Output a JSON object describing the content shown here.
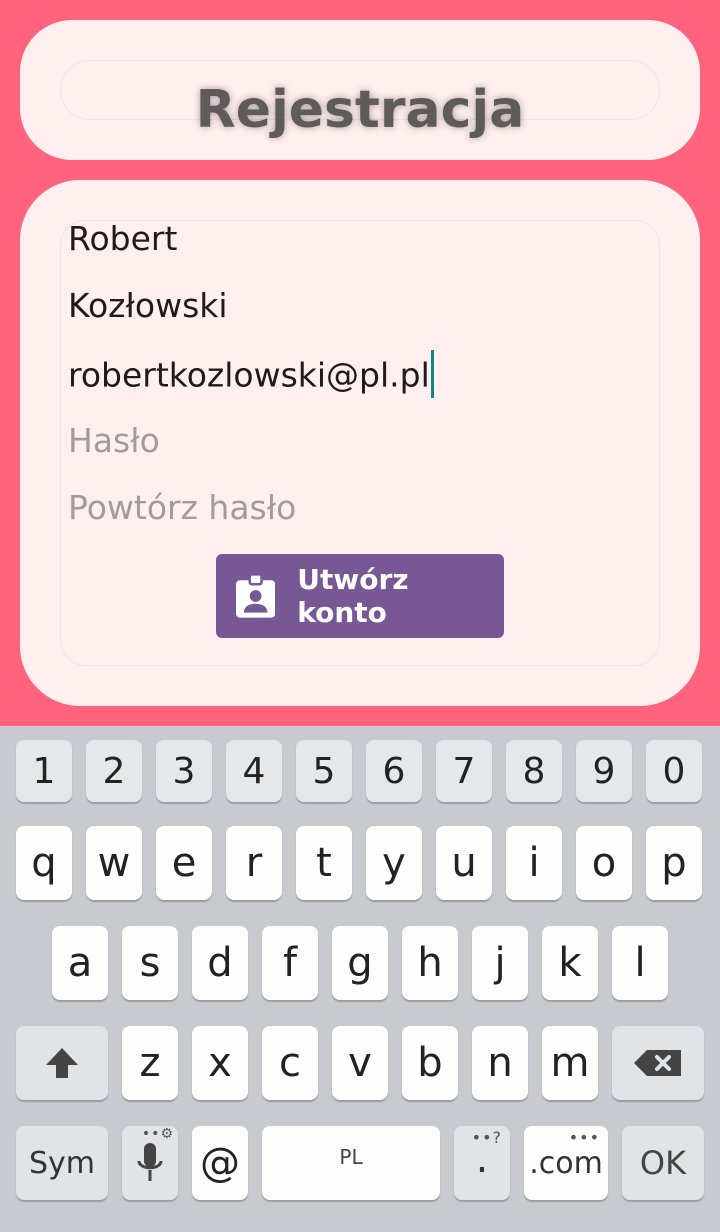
{
  "header": {
    "title": "Rejestracja"
  },
  "form": {
    "first_name_value": "Robert",
    "last_name_value": "Kozłowski",
    "email_value": "robertkozlowski@pl.pl",
    "password_placeholder": "Hasło",
    "repeat_password_placeholder": "Powtórz hasło",
    "create_button_label": "Utwórz konto",
    "create_button_icon": "account-badge-icon"
  },
  "colors": {
    "background": "#ff637d",
    "card": "#fff0ef",
    "button": "#775895",
    "cursor": "#0f8a7f"
  },
  "keyboard": {
    "numbers": [
      "1",
      "2",
      "3",
      "4",
      "5",
      "6",
      "7",
      "8",
      "9",
      "0"
    ],
    "row1": [
      "q",
      "w",
      "e",
      "r",
      "t",
      "y",
      "u",
      "i",
      "o",
      "p"
    ],
    "row2": [
      "a",
      "s",
      "d",
      "f",
      "g",
      "h",
      "j",
      "k",
      "l"
    ],
    "row3": [
      "z",
      "x",
      "c",
      "v",
      "b",
      "n",
      "m"
    ],
    "sym_label": "Sym",
    "at_label": "@",
    "space_label": "PL",
    "period_label": ".",
    "period_hint": "••?",
    "com_label": ".com",
    "com_hint": "•••",
    "ok_label": "OK",
    "shift_icon": "shift-arrow-icon",
    "backspace_icon": "backspace-icon",
    "mic_icon": "microphone-icon"
  }
}
